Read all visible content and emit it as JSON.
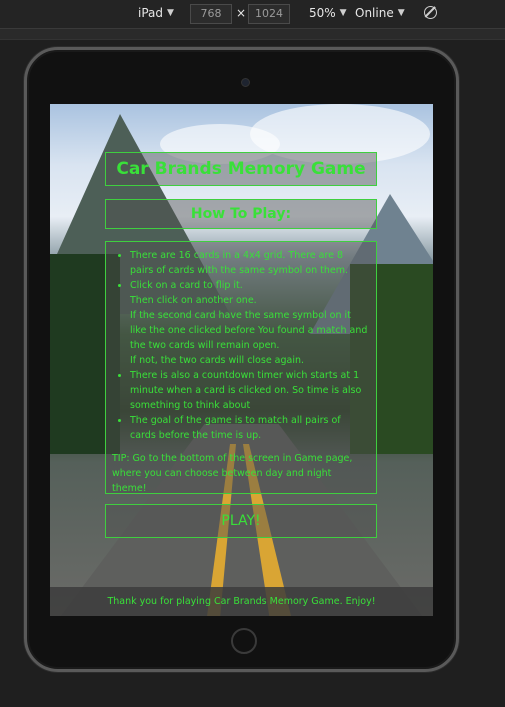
{
  "devtools": {
    "device": "iPad",
    "width": "768",
    "height": "1024",
    "separator": "×",
    "zoom": "50%",
    "network": "Online",
    "icons": [
      "caret-down-icon",
      "rotate-icon"
    ]
  },
  "game": {
    "title": "Car Brands Memory Game",
    "how_to_play": "How To Play:",
    "rules": [
      [
        "There are 16 cards in a 4x4 grid. There are 8 pairs of cards with the same symbol on them."
      ],
      [
        "Click on a card to flip it.",
        "Then click on another one.",
        "If the second card have the same symbol on it like the one clicked before You found a match and the two cards will remain open.",
        "If not, the two cards will close again."
      ],
      [
        "There is also a countdown timer wich starts at 1 minute when a card is clicked on. So time is also something to think about"
      ],
      [
        "The goal of the game is to match all pairs of cards before the time is up."
      ]
    ],
    "tip": "TIP: Go to the bottom of the screen in Game page, where you can choose between day and night theme!",
    "play_label": "PLAY!",
    "footer": "Thank you for playing Car Brands Memory Game. Enjoy!"
  },
  "colors": {
    "accent": "#39e039",
    "page_bg": "#1f1f1f"
  }
}
